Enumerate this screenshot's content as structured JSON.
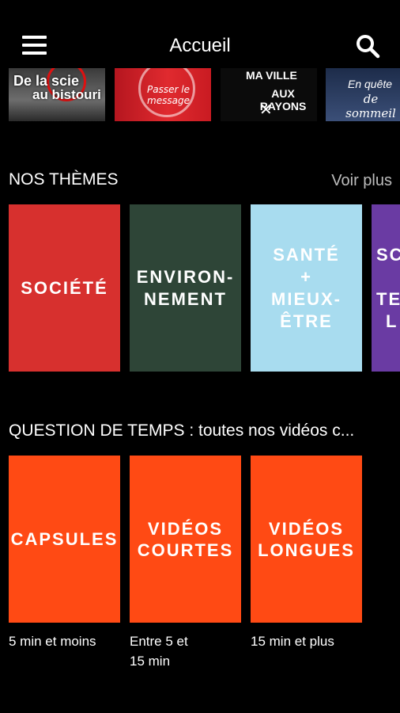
{
  "header": {
    "title": "Accueil",
    "menu_icon": "hamburger-menu-icon",
    "search_icon": "search-icon"
  },
  "featured": [
    {
      "line1": "De la scie",
      "line2": "au bistouri"
    },
    {
      "line1": "Passer le message"
    },
    {
      "line1": "MA VILLE",
      "line2": "AUX RAYONS"
    },
    {
      "line1": "En quête",
      "line2": "de sommeil"
    }
  ],
  "themes": {
    "title": "NOS THÈMES",
    "see_more": "Voir plus",
    "items": [
      {
        "label": "SOCIÉTÉ",
        "color": "#d7302e"
      },
      {
        "label": "ENVIRON-NEMENT",
        "line1": "ENVIRON-",
        "line2": "NEMENT",
        "color": "#2e4537"
      },
      {
        "label": "SANTÉ + MIEUX-ÊTRE",
        "line1": "SANTÉ",
        "line2": "+",
        "line3": "MIEUX-",
        "line4": "ÊTRE",
        "color": "#a8dcef"
      },
      {
        "label": "SC TE L",
        "line1": "SC",
        "line2": "TE",
        "line3": "L",
        "color": "#6a3ba3"
      }
    ]
  },
  "durations": {
    "title": "QUESTION DE TEMPS : toutes nos vidéos c...",
    "items": [
      {
        "label": "CAPSULES",
        "sub": "5 min et moins"
      },
      {
        "label": "VIDÉOS COURTES",
        "line1": "VIDÉOS",
        "line2": "COURTES",
        "sub_line1": "Entre 5 et",
        "sub_line2": "15 min"
      },
      {
        "label": "VIDÉOS LONGUES",
        "line1": "VIDÉOS",
        "line2": "LONGUES",
        "sub": "15 min et plus"
      }
    ],
    "tile_color": "#ff4a14"
  }
}
